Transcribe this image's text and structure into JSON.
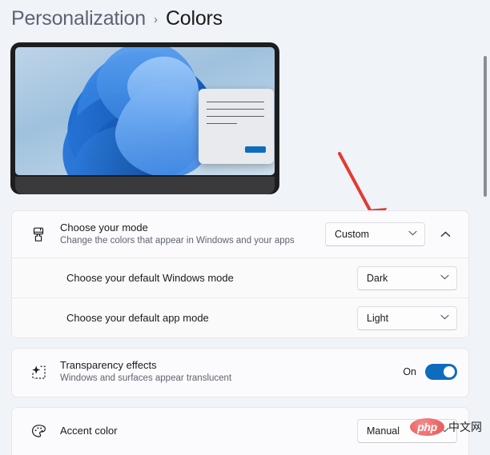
{
  "breadcrumb": {
    "root": "Personalization",
    "separator": "›",
    "current": "Colors"
  },
  "preview": {
    "name": "desktop-wallpaper-preview",
    "wallpaper": "windows-11-bloom",
    "dialog_button_color": "#0f6cbd"
  },
  "annotation": {
    "arrow_color": "#e23b34",
    "points_to": "Custom"
  },
  "settings": {
    "mode": {
      "title": "Choose your mode",
      "description": "Change the colors that appear in Windows and your apps",
      "icon": "paintbrush-icon",
      "value": "Custom",
      "expanded": true,
      "sub_rows": [
        {
          "title": "Choose your default Windows mode",
          "value": "Dark"
        },
        {
          "title": "Choose your default app mode",
          "value": "Light"
        }
      ]
    },
    "transparency": {
      "title": "Transparency effects",
      "description": "Windows and surfaces appear translucent",
      "icon": "sparkle-icon",
      "toggle_label": "On",
      "toggle_on": true,
      "accent_color": "#0f6cbd"
    },
    "accent": {
      "title": "Accent color",
      "icon": "palette-icon",
      "value": "Manual"
    }
  },
  "watermark": {
    "badge": "php",
    "text": "中文网"
  }
}
